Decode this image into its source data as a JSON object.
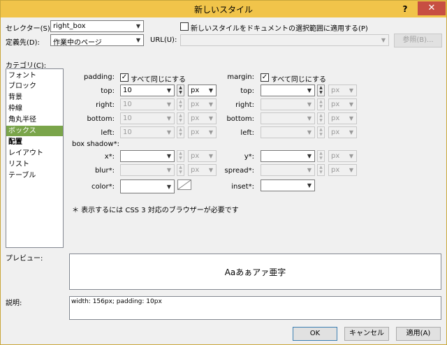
{
  "window": {
    "title": "新しいスタイル",
    "help": "?",
    "close": "✕"
  },
  "top": {
    "selector_label": "セレクター(S):",
    "selector_value": "right_box",
    "define_in_label": "定義先(D):",
    "define_in_value": "作業中のページ",
    "url_label": "URL(U):",
    "url_value": "",
    "apply_selection_label": "新しいスタイルをドキュメントの選択範囲に適用する(P)",
    "apply_selection_checked": false,
    "browse_button": "参照(B)..."
  },
  "category": {
    "label": "カテゴリ(C):",
    "items": [
      "フォント",
      "ブロック",
      "背景",
      "枠線",
      "角丸半径",
      "ボックス",
      "配置",
      "レイアウト",
      "リスト",
      "テーブル"
    ],
    "selected": "ボックス"
  },
  "box": {
    "padding_label": "padding:",
    "margin_label": "margin:",
    "same_all_label": "すべて同じにする",
    "padding_same": true,
    "margin_same": true,
    "padding": {
      "top": {
        "label": "top:",
        "value": "10",
        "unit": "px"
      },
      "right": {
        "label": "right:",
        "value": "10",
        "unit": "px"
      },
      "bottom": {
        "label": "bottom:",
        "value": "10",
        "unit": "px"
      },
      "left": {
        "label": "left:",
        "value": "10",
        "unit": "px"
      }
    },
    "margin": {
      "top": {
        "label": "top:",
        "value": "",
        "unit": "px"
      },
      "right": {
        "label": "right:",
        "value": "",
        "unit": "px"
      },
      "bottom": {
        "label": "bottom:",
        "value": "",
        "unit": "px"
      },
      "left": {
        "label": "left:",
        "value": "",
        "unit": "px"
      }
    },
    "shadow_label": "box shadow*:",
    "x_label": "x*:",
    "y_label": "y*:",
    "blur_label": "blur*:",
    "spread_label": "spread*:",
    "color_label": "color*:",
    "inset_label": "inset*:",
    "unit_px": "px",
    "note": "＊ 表示するには CSS 3 対応のブラウザーが必要です"
  },
  "preview": {
    "label": "プレビュー:",
    "text": "Aaあぁアァ亜字"
  },
  "description": {
    "label": "説明:",
    "text": "width: 156px; padding: 10px"
  },
  "buttons": {
    "ok": "OK",
    "cancel": "キャンセル",
    "apply": "適用(A)"
  },
  "colors": {
    "titlebar": "#f1c44a",
    "close": "#c74f42",
    "selection": "#7aa54a"
  }
}
